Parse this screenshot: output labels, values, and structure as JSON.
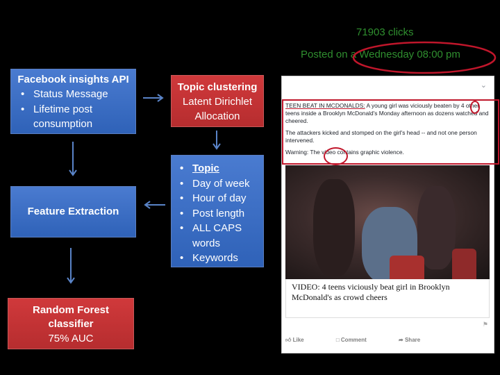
{
  "api_box": {
    "title": "Facebook insights API",
    "items": [
      "Status Message",
      "Lifetime post consumption"
    ]
  },
  "topic_box": {
    "title": "Topic clustering",
    "subtitle": "Latent Dirichlet Allocation"
  },
  "features_box": {
    "items": [
      "Topic",
      "Day of week",
      "Hour of day",
      "Post length",
      "ALL CAPS words",
      "Keywords"
    ]
  },
  "extraction_box": {
    "title": "Feature Extraction"
  },
  "classifier_box": {
    "title": "Random Forest classifier",
    "subtitle": "75% AUC"
  },
  "post_stats": {
    "clicks": "71903 clicks",
    "posted_prefix": "Posted on ",
    "posted_when": "a Wednesday 08:00 pm"
  },
  "fb_post": {
    "headline": "TEEN BEAT IN MCDONALDS:",
    "body1": " A young girl was viciously beaten by 4 other teens inside a Brooklyn McDonald's Monday afternoon as dozens watched and cheered.",
    "body2": "The attackers kicked and stomped on the girl's head -- and not one person intervened.",
    "warning": "Warning: The video contains graphic violence.",
    "link_title": "VIDEO: 4 teens viciously beat girl in Brooklyn McDonald's as crowd cheers",
    "actions": [
      "Like",
      "Comment",
      "Share"
    ]
  },
  "colors": {
    "blue_box": "#3b6fc6",
    "red_box": "#c33234",
    "arrow": "#5a84c8",
    "green_text": "#2f8f2f",
    "highlight": "#c0162b"
  }
}
